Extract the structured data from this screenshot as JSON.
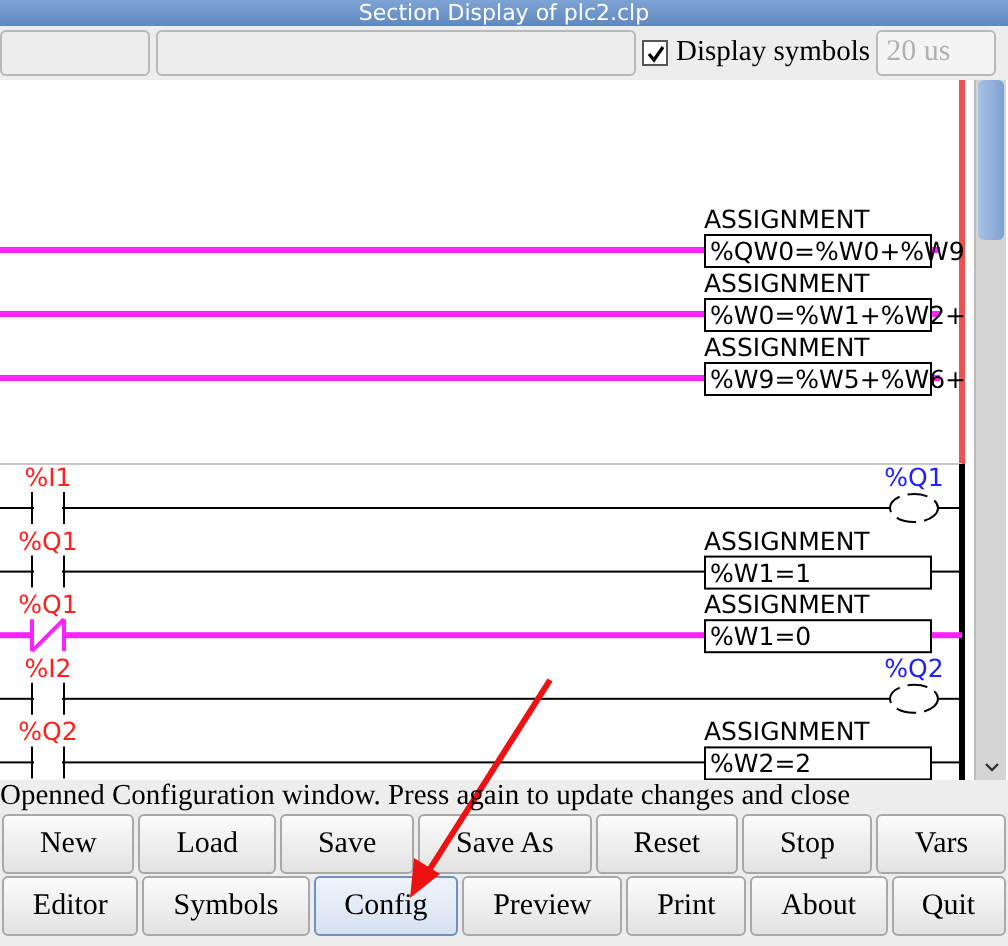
{
  "window": {
    "title": "Section Display of plc2.clp"
  },
  "toolbar": {
    "display_symbols": {
      "label": "Display symbols",
      "checked": true
    },
    "period": {
      "value": "20 us",
      "disabled": true
    }
  },
  "upper_rungs": [
    {
      "kind": "assignment",
      "active": true,
      "label": "ASSIGNMENT",
      "expression": "%QW0=%W0+%W9"
    },
    {
      "kind": "assignment",
      "active": true,
      "label": "ASSIGNMENT",
      "expression": "%W0=%W1+%W2+"
    },
    {
      "kind": "assignment",
      "active": true,
      "label": "ASSIGNMENT",
      "expression": "%W9=%W5+%W6+"
    }
  ],
  "lower_rungs": [
    {
      "kind": "coil",
      "active": false,
      "contact": {
        "label": "%I1",
        "negated": false
      },
      "coil": "%Q1"
    },
    {
      "kind": "assignment",
      "active": false,
      "contact": {
        "label": "%Q1",
        "negated": false
      },
      "label": "ASSIGNMENT",
      "expression": "%W1=1"
    },
    {
      "kind": "assignment",
      "active": true,
      "contact": {
        "label": "%Q1",
        "negated": true
      },
      "label": "ASSIGNMENT",
      "expression": "%W1=0"
    },
    {
      "kind": "coil",
      "active": false,
      "contact": {
        "label": "%I2",
        "negated": false
      },
      "coil": "%Q2"
    },
    {
      "kind": "assignment",
      "active": false,
      "contact": {
        "label": "%Q2",
        "negated": false
      },
      "label": "ASSIGNMENT",
      "expression": "%W2=2"
    }
  ],
  "status_bar": "Openned Configuration window. Press again to update changes and close",
  "button_rows": [
    [
      {
        "label": "New",
        "selected": false
      },
      {
        "label": "Load",
        "selected": false
      },
      {
        "label": "Save",
        "selected": false
      },
      {
        "label": "Save As",
        "selected": false
      },
      {
        "label": "Reset",
        "selected": false
      },
      {
        "label": "Stop",
        "selected": false
      },
      {
        "label": "Vars",
        "selected": false
      }
    ],
    [
      {
        "label": "Editor",
        "selected": false
      },
      {
        "label": "Symbols",
        "selected": false
      },
      {
        "label": "Config",
        "selected": true
      },
      {
        "label": "Preview",
        "selected": false
      },
      {
        "label": "Print",
        "selected": false
      },
      {
        "label": "About",
        "selected": false
      },
      {
        "label": "Quit",
        "selected": false
      }
    ]
  ]
}
